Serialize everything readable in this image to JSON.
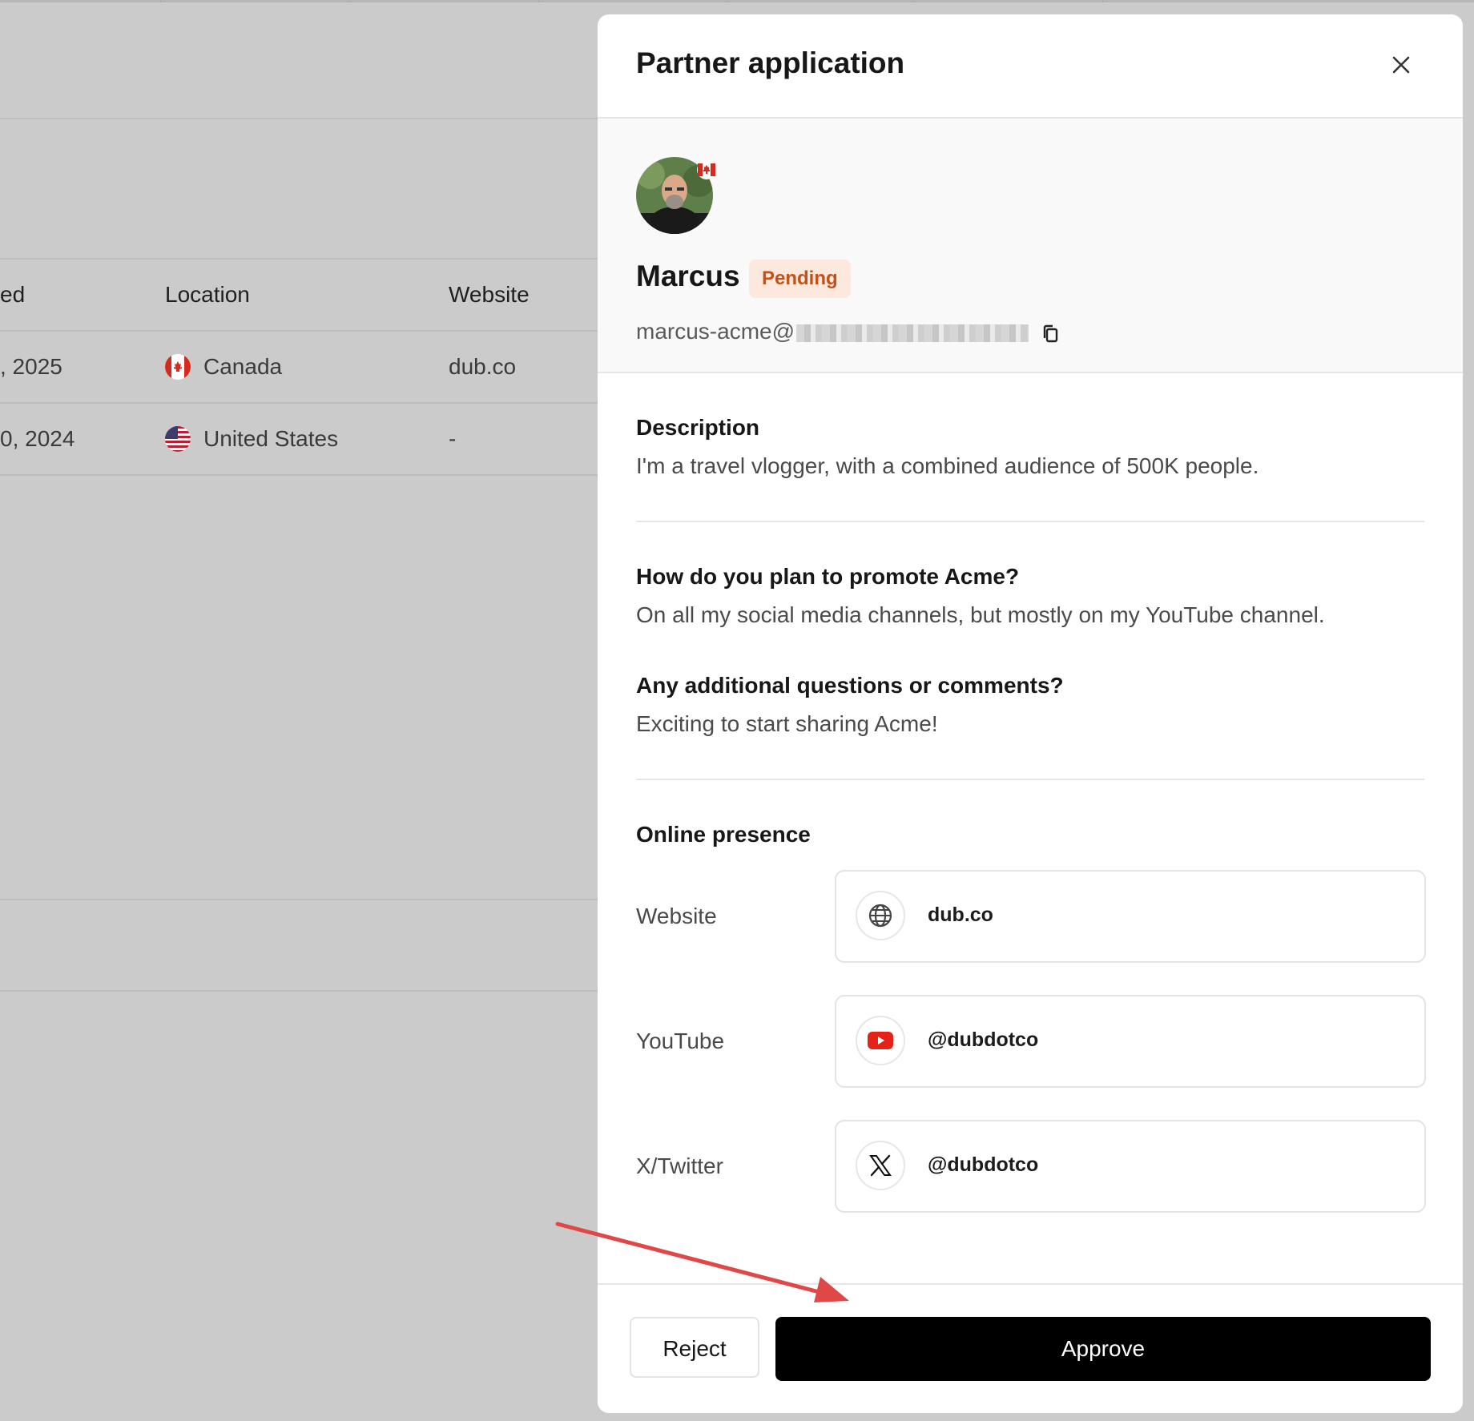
{
  "background_table": {
    "headers": {
      "date_fragment": "ed",
      "location": "Location",
      "website": "Website"
    },
    "rows": [
      {
        "date_fragment": ", 2025",
        "location": "Canada",
        "flag": "canada-flag-icon",
        "website": "dub.co"
      },
      {
        "date_fragment": "0, 2024",
        "location": "United States",
        "flag": "us-flag-icon",
        "website": "-"
      }
    ]
  },
  "panel": {
    "title": "Partner application",
    "close_icon": "close-icon"
  },
  "profile": {
    "name": "Marcus",
    "status": "Pending",
    "email_prefix": "marcus-acme@",
    "avatar_flag": "canada-flag-icon"
  },
  "description": {
    "title": "Description",
    "text": "I'm a travel vlogger, with a combined audience of 500K people."
  },
  "questions": [
    {
      "title": "How do you plan to promote Acme?",
      "text": "On all my social media channels, but mostly on my YouTube channel."
    },
    {
      "title": "Any additional questions or comments?",
      "text": "Exciting to start sharing Acme!"
    }
  ],
  "online_presence": {
    "title": "Online presence",
    "items": [
      {
        "label": "Website",
        "value": "dub.co",
        "icon": "globe-icon"
      },
      {
        "label": "YouTube",
        "value": "@dubdotco",
        "icon": "youtube-icon"
      },
      {
        "label": "X/Twitter",
        "value": "@dubdotco",
        "icon": "x-twitter-icon"
      }
    ]
  },
  "footer": {
    "reject_label": "Reject",
    "approve_label": "Approve"
  },
  "colors": {
    "overlay_bg": "#cbcbcb",
    "pending_bg": "#fce8dd",
    "pending_text": "#c2521a",
    "approve_bg": "#000000",
    "annotation_arrow": "#e04848"
  }
}
